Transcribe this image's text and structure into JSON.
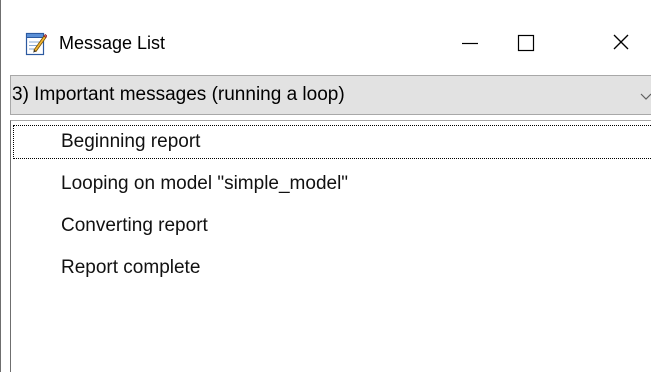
{
  "window": {
    "title": "Message List",
    "icons": {
      "app": "notepad-pencil-icon",
      "minimize": "minimize-icon",
      "maximize": "maximize-icon",
      "close": "close-icon"
    }
  },
  "filter": {
    "selected": "3) Important messages (running a loop)",
    "dropdown_icon": "chevron-down-icon"
  },
  "messages": [
    {
      "label": "Beginning report",
      "focused": true
    },
    {
      "label": "Looping on model \"simple_model\"",
      "focused": false
    },
    {
      "label": "Converting report",
      "focused": false
    },
    {
      "label": "Report complete",
      "focused": false
    }
  ],
  "colors": {
    "combo_background": "#e2e2e2",
    "border": "#a8a8a8",
    "window_background": "#ffffff"
  }
}
